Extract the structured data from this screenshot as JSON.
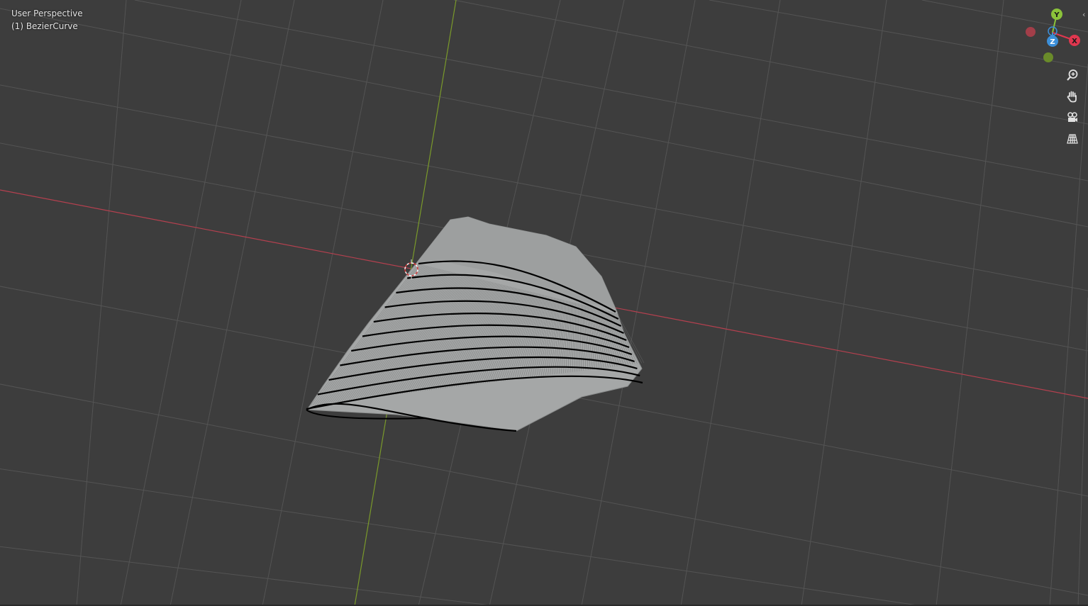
{
  "viewport": {
    "view_name": "User Perspective",
    "object_label": "(1) BezierCurve"
  },
  "gizmo": {
    "y_label": "Y",
    "z_label": "Z",
    "x_label": "X"
  },
  "nav_tools": {
    "zoom": "zoom-in-icon",
    "pan": "hand-icon",
    "camera": "camera-icon",
    "perspective": "grid-icon"
  },
  "colors": {
    "background": "#3d3d3d",
    "grid": "#545454",
    "x_axis": "#b5404f",
    "y_axis": "#7a9a2a",
    "y_gizmo": "#8bc33a",
    "z_gizmo": "#3c8fd9",
    "x_gizmo": "#e0374f",
    "mesh": "#a4a6a6",
    "curve": "#000000"
  }
}
